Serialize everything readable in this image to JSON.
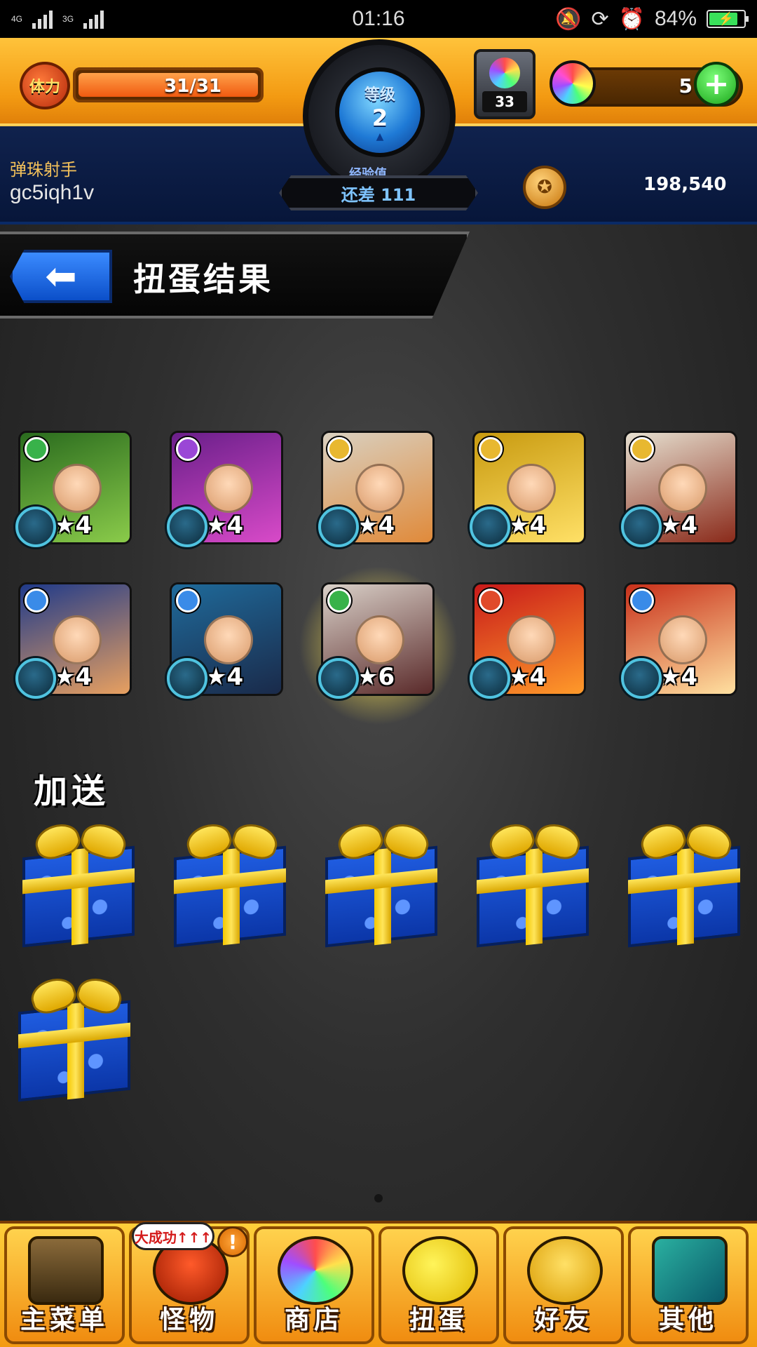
{
  "status_bar": {
    "network_1": "4G",
    "network_2": "3G",
    "time": "01:16",
    "battery_percent": "84%",
    "battery_level": 0.84,
    "icons": [
      "mute-icon",
      "rotation-lock-icon",
      "alarm-icon",
      "battery-charging-icon"
    ]
  },
  "header": {
    "stamina_label": "体力",
    "stamina_value": "31/31",
    "stamina_fraction": 1.0,
    "level_label": "等级",
    "level_value": "2",
    "exp_label": "经验值",
    "exp_remaining": "还差 111",
    "orb_box_count": "33",
    "orb_count": "5",
    "plus_symbol": "+",
    "player_title": "弹珠射手",
    "player_name": "gc5iqh1v",
    "coins": "198,540"
  },
  "page": {
    "title": "扭蛋结果",
    "back_icon": "back-arrow-icon"
  },
  "results": [
    {
      "rarity": "★4",
      "element": "wood",
      "element_color": "#38b24a",
      "art": [
        "#2a6b1e",
        "#8acb4a"
      ]
    },
    {
      "rarity": "★4",
      "element": "dark",
      "element_color": "#9a47d6",
      "art": [
        "#6a1f8a",
        "#d84ac8"
      ]
    },
    {
      "rarity": "★4",
      "element": "light",
      "element_color": "#e8b830",
      "art": [
        "#d9d0c0",
        "#e08a3a"
      ]
    },
    {
      "rarity": "★4",
      "element": "light",
      "element_color": "#e8b830",
      "art": [
        "#c89a10",
        "#ffe066"
      ]
    },
    {
      "rarity": "★4",
      "element": "light",
      "element_color": "#e8b830",
      "art": [
        "#e6e0d0",
        "#8a2a1a"
      ]
    },
    {
      "rarity": "★4",
      "element": "water",
      "element_color": "#3a8be8",
      "art": [
        "#1f3a8a",
        "#e8a060"
      ]
    },
    {
      "rarity": "★4",
      "element": "water",
      "element_color": "#3a8be8",
      "art": [
        "#1f6a9a",
        "#1a2a4a"
      ]
    },
    {
      "rarity": "★6",
      "element": "wood",
      "element_color": "#38b24a",
      "art": [
        "#d9d0c8",
        "#5a2a2a"
      ]
    },
    {
      "rarity": "★4",
      "element": "fire",
      "element_color": "#e04a2a",
      "art": [
        "#c81a1a",
        "#ff9a2a"
      ]
    },
    {
      "rarity": "★4",
      "element": "water",
      "element_color": "#3a8be8",
      "art": [
        "#c8301a",
        "#ffe0a0"
      ]
    }
  ],
  "bonus": {
    "label": "加送",
    "gift_count": 6,
    "gift_icon": "gift-box-icon"
  },
  "bottom_nav": [
    {
      "label": "主菜单",
      "icon": "main-menu-gate-icon"
    },
    {
      "label": "怪物",
      "icon": "monster-icon"
    },
    {
      "label": "商店",
      "icon": "shop-orb-icon"
    },
    {
      "label": "扭蛋",
      "icon": "gacha-egg-icon"
    },
    {
      "label": "好友",
      "icon": "friends-icon"
    },
    {
      "label": "其他",
      "icon": "other-icon"
    }
  ],
  "monster_badge": {
    "text": "大成功↑↑↑",
    "alert": "!"
  }
}
